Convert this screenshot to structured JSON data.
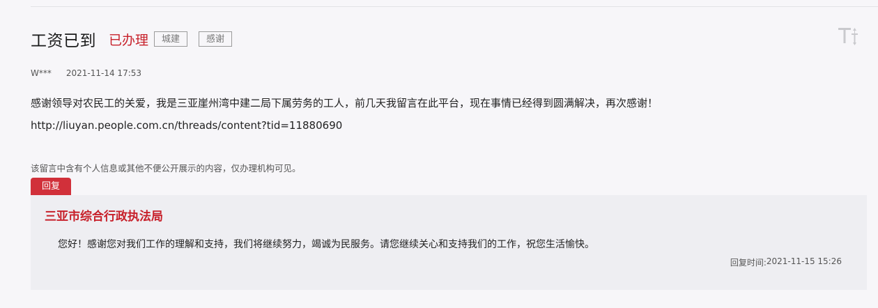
{
  "post": {
    "title": "工资已到",
    "status": "已办理",
    "tags": [
      "城建",
      "感谢"
    ],
    "author": "W***",
    "date": "2021-11-14 17:53",
    "content_lines": [
      "感谢领导对农民工的关爱，我是三亚崖州湾中建二局下属劳务的工人，前几天我留言在此平台，现在事情已经得到圆满解决，再次感谢！",
      "http://liuyan.people.com.cn/threads/content?tid=11880690"
    ],
    "privacy_notice": "该留言中含有个人信息或其他不便公开展示的内容，仅办理机构可见。"
  },
  "toolbar": {
    "font_size_icon": "font-size-icon"
  },
  "reply": {
    "tab_label": "回复",
    "organization": "三亚市综合行政执法局",
    "text": "您好！感谢您对我们工作的理解和支持，我们将继续努力，竭诚为民服务。请您继续关心和支持我们的工作，祝您生活愉快。",
    "time_label": "回复时间:",
    "time_value": "2021-11-15 15:26"
  },
  "colors": {
    "accent_red": "#c7202a",
    "tab_red": "#d1303a",
    "page_bg": "#f7f6f9",
    "reply_bg": "#eeeef2"
  }
}
